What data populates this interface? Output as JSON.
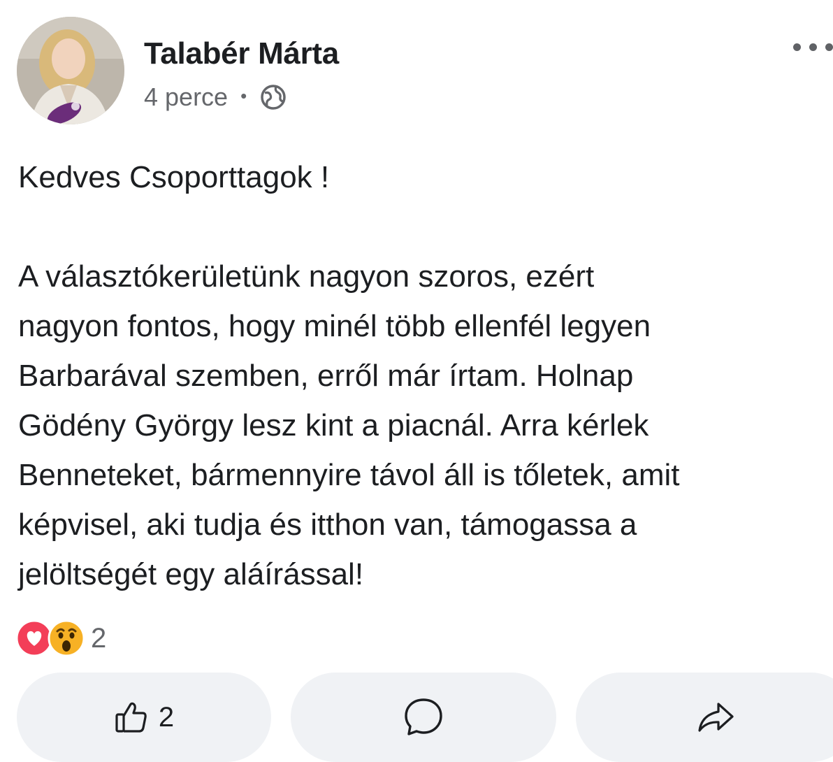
{
  "post": {
    "author": "Talabér Márta",
    "time": "4 perce",
    "separator": "•",
    "audience_icon": "globe-icon",
    "menu_icon": "more-dots-icon",
    "greeting": "Kedves Csoporttagok !",
    "body": "A választókerületünk nagyon szoros, ezért\nnagyon fontos, hogy minél több ellenfél legyen\nBarbarával szemben, erről már írtam. Holnap\nGödény György lesz kint a piacnál. Arra kérlek\nBenneteket, bármennyire távol áll is tőletek, amit\nképvisel, aki tudja és itthon van, támogassa a\njelöltségét egy aláírással!"
  },
  "reactions": {
    "icons": [
      "love-reaction-icon",
      "wow-reaction-icon"
    ],
    "count": "2"
  },
  "actions": {
    "like_count": "2",
    "like_icon": "thumbs-up-icon",
    "comment_icon": "comment-bubble-icon",
    "share_icon": "share-arrow-icon"
  },
  "colors": {
    "text": "#1c1e21",
    "secondary": "#65676b",
    "button_bg": "#f0f2f5",
    "love": "#f33e58",
    "wow": "#f7b125"
  }
}
